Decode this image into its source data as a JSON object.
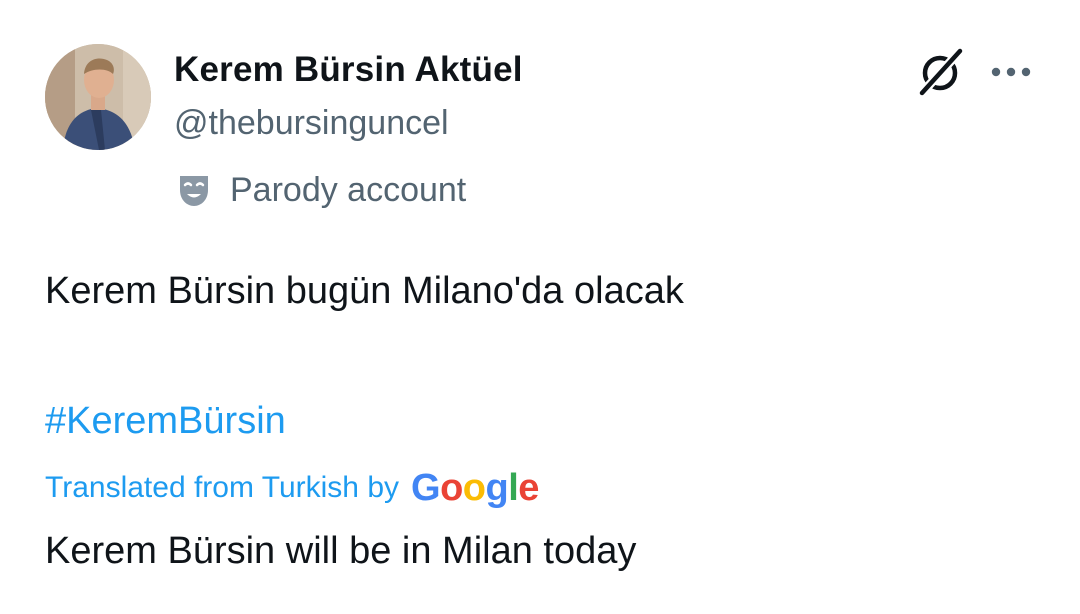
{
  "author": {
    "display_name": "Kerem Bürsin Aktüel",
    "handle": "@thebursinguncel",
    "parody_label": "Parody account",
    "avatar_icon": "profile-photo"
  },
  "actions": {
    "grok_icon": "grok-icon",
    "more_icon": "more-options-icon"
  },
  "tweet": {
    "text": "Kerem Bürsin bugün Milano'da olacak",
    "hashtag": "#KeremBürsin",
    "translated_label": "Translated from Turkish by",
    "translator_logo": "Google",
    "translation": "Kerem Bürsin will be in Milan today"
  },
  "colors": {
    "link": "#1d9bf0",
    "secondary_text": "#536471",
    "primary_text": "#0f1419",
    "google_g": "#4285F4",
    "google_o1": "#EA4335",
    "google_o2": "#FBBC05",
    "google_g2": "#4285F4",
    "google_l": "#34A853",
    "google_e": "#EA4335"
  }
}
